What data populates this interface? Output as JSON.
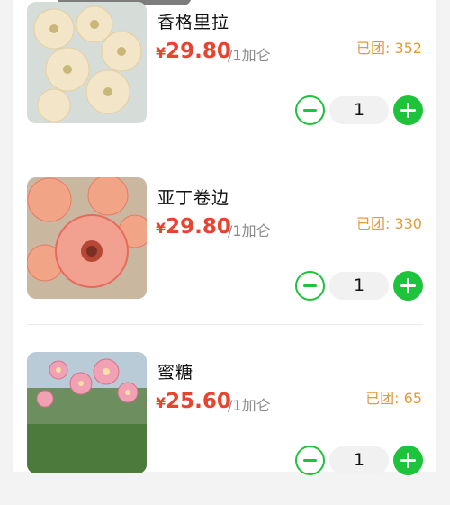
{
  "products": [
    {
      "name": "香格里拉",
      "currency": "¥",
      "price": "29.80",
      "unit": "/1加仑",
      "sold": "已团: 352",
      "quantity": "1",
      "thumb_colors": [
        "#f3e6c8",
        "#e9d3a6",
        "#cfd9cf"
      ]
    },
    {
      "name": "亚丁卷边",
      "currency": "¥",
      "price": "29.80",
      "unit": "/1加仑",
      "sold": "已团: 330",
      "quantity": "1",
      "thumb_colors": [
        "#f2a487",
        "#e76a58",
        "#d9c6a6"
      ]
    },
    {
      "name": "蜜糖",
      "currency": "¥",
      "price": "25.60",
      "unit": "/1加仑",
      "sold": "已团: 65",
      "quantity": "1",
      "thumb_colors": [
        "#f0a2b4",
        "#4c7a3c",
        "#b9cbd6"
      ]
    }
  ],
  "colors": {
    "price": "#e8432f",
    "sold": "#e59a3a",
    "accent_green": "#1ec33c"
  }
}
